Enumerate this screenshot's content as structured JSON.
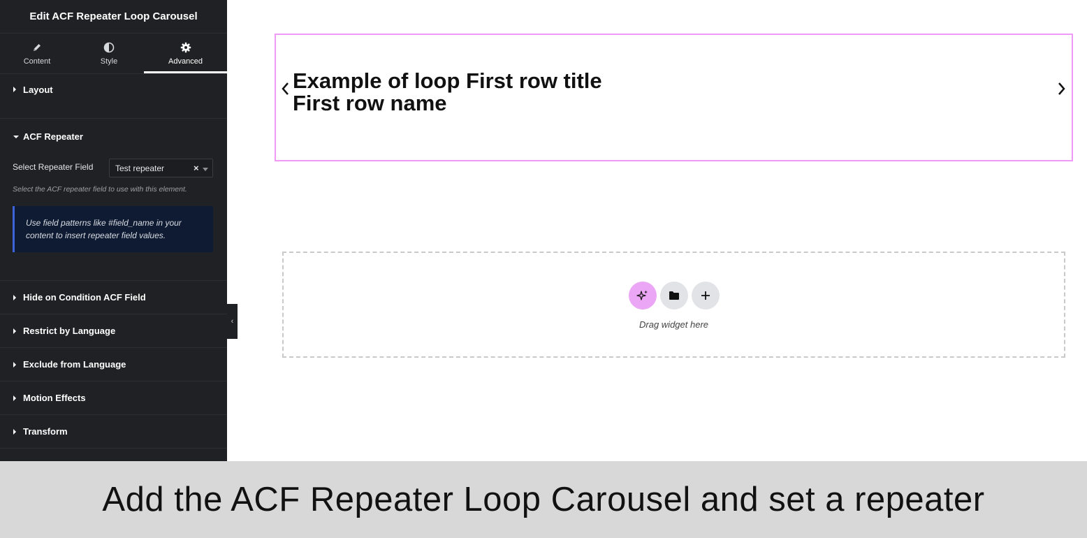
{
  "panel": {
    "title": "Edit ACF Repeater Loop Carousel",
    "tabs": [
      {
        "label": "Content",
        "icon": "pencil-icon"
      },
      {
        "label": "Style",
        "icon": "contrast-icon"
      },
      {
        "label": "Advanced",
        "icon": "gear-icon",
        "active": true
      }
    ],
    "sections": {
      "layout": "Layout",
      "acf_repeater": "ACF Repeater",
      "hide_condition": "Hide on Condition ACF Field",
      "restrict_language": "Restrict by Language",
      "exclude_language": "Exclude from Language",
      "motion_effects": "Motion Effects",
      "transform": "Transform"
    },
    "repeater_field": {
      "label": "Select Repeater Field",
      "value": "Test repeater",
      "help": "Select the ACF repeater field to use with this element.",
      "notice": "Use field patterns like #field_name in your content to insert repeater field values."
    }
  },
  "canvas": {
    "carousel": {
      "line1": "Example of loop First row title",
      "line2": "First row name"
    },
    "dropzone": {
      "label": "Drag widget here",
      "buttons": [
        "ai-sparkle-icon",
        "folder-icon",
        "plus-icon"
      ]
    }
  },
  "caption": "Add the ACF Repeater Loop Carousel and set a repeater",
  "colors": {
    "panel_bg": "#202124",
    "carousel_border": "#ef9af7",
    "notice_bg": "#0f1b33",
    "notice_accent": "#3a64d8",
    "ai_button": "#eba6f5"
  }
}
